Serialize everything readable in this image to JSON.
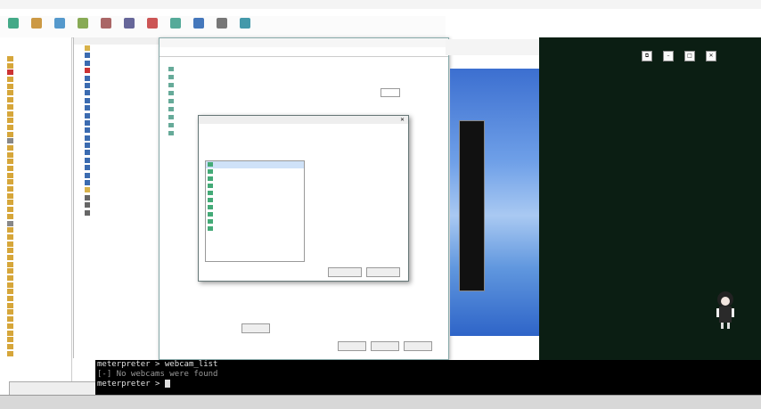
{
  "terminal": {
    "line1_prompt": "meterpreter > ",
    "line1_cmd": "webcam_list",
    "line2": "[-] No webcams were found",
    "line3_prompt": "meterpreter > "
  },
  "colors": {
    "terminal_bg": "#000000",
    "terminal_fg": "#e0e0e0",
    "dark_panel": "#0b1e13",
    "vm_sky": "#5f96de"
  },
  "icons": [
    "folder-icon",
    "computer-icon",
    "drive-icon",
    "gear-icon",
    "close-icon",
    "minimize-icon",
    "maximize-icon",
    "restore-icon"
  ]
}
